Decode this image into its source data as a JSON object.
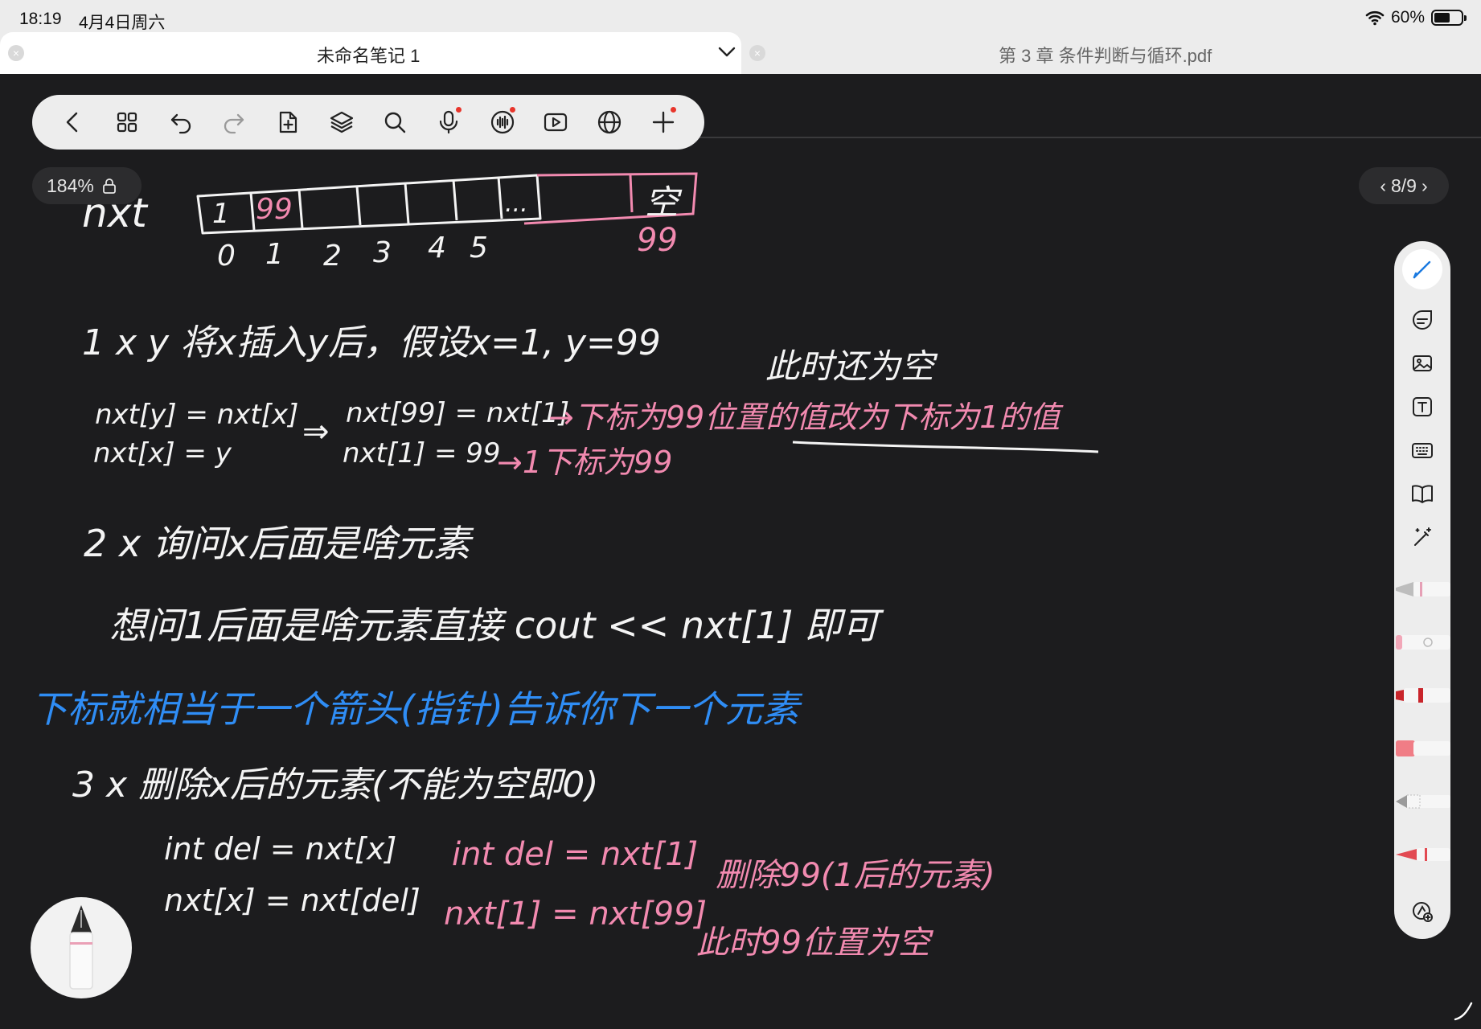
{
  "status_bar": {
    "time": "18:19",
    "date": "4月4日周六",
    "battery_percent": "60%",
    "battery_level": 0.6
  },
  "tabs": {
    "left_title": "未命名笔记 1",
    "right_title": "第 3 章 条件判断与循环.pdf"
  },
  "toolbar": {
    "icons": [
      "back-icon",
      "grid-icon",
      "undo-icon",
      "redo-icon",
      "add-page-icon",
      "layers-icon",
      "search-icon",
      "microphone-icon",
      "audio-wave-icon",
      "video-play-icon",
      "globe-icon",
      "plus-icon"
    ]
  },
  "zoom": {
    "label": "184%"
  },
  "page_nav": {
    "label": "8/9"
  },
  "rail": {
    "icons": [
      "pen-icon",
      "sticker-icon",
      "image-icon",
      "text-box-icon",
      "keyboard-icon",
      "book-icon",
      "magic-wand-icon",
      "pen-settings-icon"
    ]
  },
  "colors": {
    "canvas": "#1c1c1e",
    "ink_white": "#f4f4f4",
    "ink_pink": "#f28ab0",
    "ink_blue": "#2f8df5",
    "accent_blue": "#1a7ae0"
  },
  "notes": {
    "array_label": "nxt",
    "cells": [
      "1",
      "99",
      "",
      "",
      "",
      "",
      "...",
      "",
      "空"
    ],
    "indices": [
      "0",
      "1",
      "2",
      "3",
      "4",
      "5",
      "99"
    ],
    "op1_title": "1  x  y   将x插入y后，假设x=1, y=99",
    "op1_note": "此时还为空",
    "op1_code1": "nxt[y] = nxt[x]",
    "op1_code2": "nxt[x] = y",
    "op1_arrow": "⇒",
    "op1_eg1": "nxt[99] = nxt[1]",
    "op1_eg1_expl": "→下标为99位置的值改为下标为1的值",
    "op1_eg2": "nxt[1] = 99",
    "op1_eg2_expl": "→1下标为99",
    "op2_title": "2 x  询问x后面是啥元素",
    "op2_body": "想问1后面是啥元素直接 cout << nxt[1] 即可",
    "tip": "下标就相当于一个箭头(指针)告诉你下一个元素",
    "op3_title": "3 x   删除x后的元素(不能为空即0)",
    "op3_code1": "int del = nxt[x]",
    "op3_code2": "nxt[x] = nxt[del]",
    "op3_eg1": "int del = nxt[1]",
    "op3_eg1_expl": "删除99(1后的元素)",
    "op3_eg2": "nxt[1] = nxt[99]",
    "op3_eg2_expl": "此时99位置为空"
  }
}
